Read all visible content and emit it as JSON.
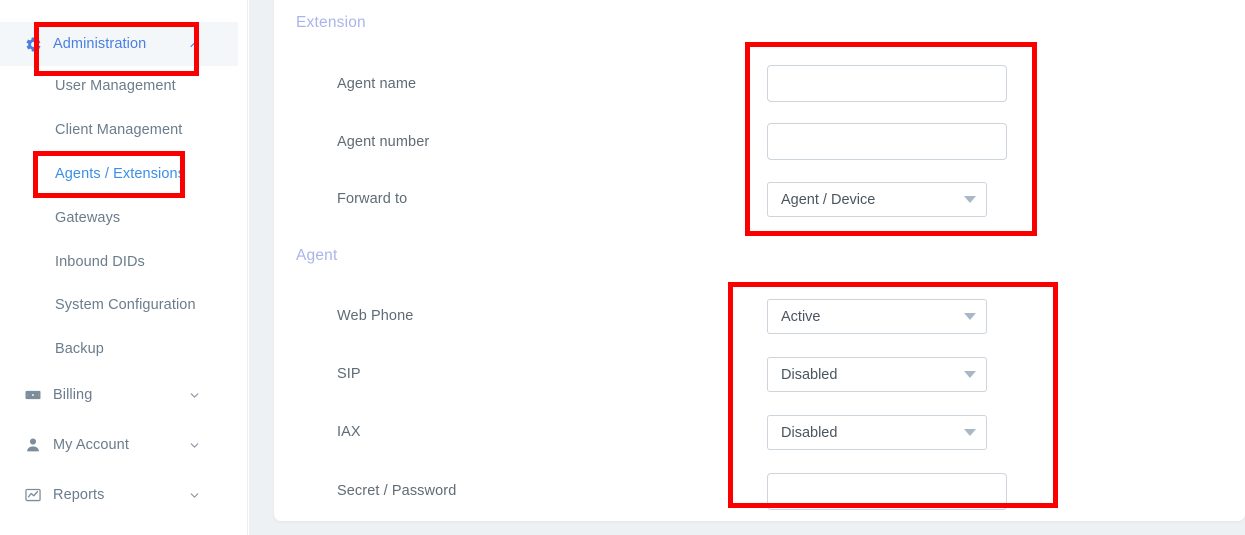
{
  "sidebar": {
    "items": [
      {
        "label": "Administration",
        "icon": "gear-icon",
        "type": "top",
        "state": "expanded-active",
        "chevron": "chevron-up-icon"
      },
      {
        "label": "User Management",
        "icon": "none",
        "type": "sub",
        "state": "normal",
        "chevron": "none"
      },
      {
        "label": "Client Management",
        "icon": "none",
        "type": "sub",
        "state": "normal",
        "chevron": "none"
      },
      {
        "label": "Agents / Extensions",
        "icon": "none",
        "type": "sub",
        "state": "selected",
        "chevron": "none"
      },
      {
        "label": "Gateways",
        "icon": "none",
        "type": "sub",
        "state": "normal",
        "chevron": "none"
      },
      {
        "label": "Inbound DIDs",
        "icon": "none",
        "type": "sub",
        "state": "normal",
        "chevron": "none"
      },
      {
        "label": "System Configuration",
        "icon": "none",
        "type": "sub",
        "state": "normal",
        "chevron": "none"
      },
      {
        "label": "Backup",
        "icon": "none",
        "type": "sub",
        "state": "normal",
        "chevron": "none"
      },
      {
        "label": "Billing",
        "icon": "banknote-icon",
        "type": "top",
        "state": "normal",
        "chevron": "chevron-down-icon"
      },
      {
        "label": "My Account",
        "icon": "person-icon",
        "type": "top",
        "state": "normal",
        "chevron": "chevron-down-icon"
      },
      {
        "label": "Reports",
        "icon": "chart-line-icon",
        "type": "top",
        "state": "normal",
        "chevron": "chevron-down-icon"
      }
    ]
  },
  "form": {
    "extension": {
      "title": "Extension",
      "agent_name_label": "Agent name",
      "agent_name_value": "",
      "agent_number_label": "Agent number",
      "agent_number_value": "",
      "forward_to_label": "Forward to",
      "forward_to_value": "Agent / Device"
    },
    "agent": {
      "title": "Agent",
      "web_phone_label": "Web Phone",
      "web_phone_value": "Active",
      "sip_label": "SIP",
      "sip_value": "Disabled",
      "iax_label": "IAX",
      "iax_value": "Disabled",
      "secret_label": "Secret / Password",
      "secret_value": ""
    }
  },
  "colors": {
    "annotation": "#fb0000",
    "link": "#3b8fe8",
    "active_nav": "#4a7fe0",
    "section_header": "#aab4ea",
    "nav_text": "#6b7c8c"
  }
}
